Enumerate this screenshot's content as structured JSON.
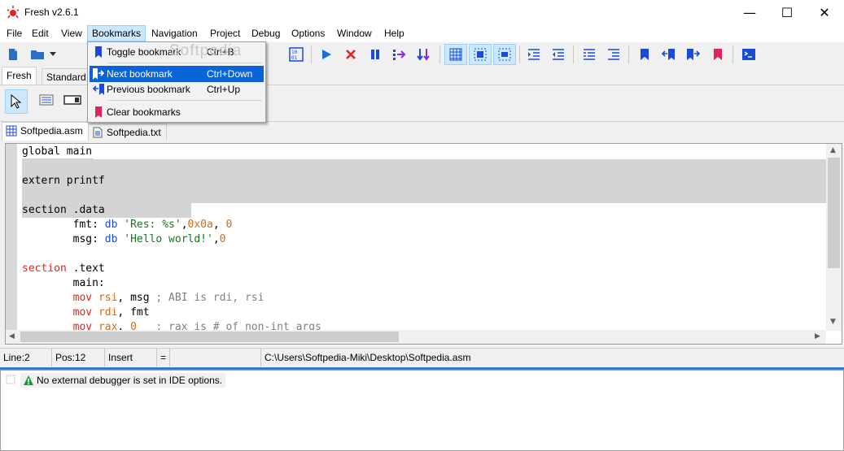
{
  "window": {
    "title": "Fresh v2.6.1",
    "minimize": "—",
    "maximize": "☐",
    "close": "✕"
  },
  "menubar": [
    "File",
    "Edit",
    "View",
    "Bookmarks",
    "Navigation",
    "Project",
    "Debug",
    "Options",
    "Window",
    "Help"
  ],
  "palette_tabs": [
    "Fresh",
    "Standard"
  ],
  "file_tabs": [
    "Softpedia.asm",
    "Softpedia.txt"
  ],
  "bookmarks_menu": [
    {
      "label": "Toggle bookmark",
      "shortcut": "Ctrl+B"
    },
    {
      "label": "Next bookmark",
      "shortcut": "Ctrl+Down"
    },
    {
      "label": "Previous bookmark",
      "shortcut": "Ctrl+Up"
    },
    {
      "label": "Clear bookmarks",
      "shortcut": ""
    }
  ],
  "watermark": "Softpedia",
  "code": {
    "l1": "global main",
    "l3": "extern printf",
    "l5": "section .data",
    "l6": {
      "indent": "        ",
      "a": "fmt: ",
      "b": "db",
      "c": " ",
      "d": "'Res: %s'",
      "e": ",",
      "f": "0x0a",
      "g": ", ",
      "h": "0"
    },
    "l7": {
      "indent": "        ",
      "a": "msg: ",
      "b": "db",
      "c": " ",
      "d": "'Hello world!'",
      "e": ",",
      "f": "0"
    },
    "l9": {
      "a": "section",
      "b": " .text"
    },
    "l10": "        main:",
    "l11": {
      "indent": "        ",
      "a": "mov",
      "b": " ",
      "c": "rsi",
      "d": ", msg ",
      "e": "; ABI is rdi, rsi"
    },
    "l12": {
      "indent": "        ",
      "a": "mov",
      "b": " ",
      "c": "rdi",
      "d": ", fmt"
    },
    "l13": {
      "indent": "        ",
      "a": "mov",
      "b": " ",
      "c": "rax",
      "d": ", ",
      "e": "0",
      "f": "   ",
      "g": "; rax is # of non-int args"
    }
  },
  "status": {
    "line": "Line:2",
    "pos": "Pos:12",
    "mode": "Insert",
    "eq": "=",
    "path": "C:\\Users\\Softpedia-Miki\\Desktop\\Softpedia.asm"
  },
  "messages": [
    "No external debugger is set in IDE options."
  ],
  "colors": {
    "accent": "#0a64d8",
    "keyword_red": "#e0241a",
    "keyword_blue": "#1a4bd4",
    "string": "#117a1a",
    "number": "#d26a1a"
  }
}
